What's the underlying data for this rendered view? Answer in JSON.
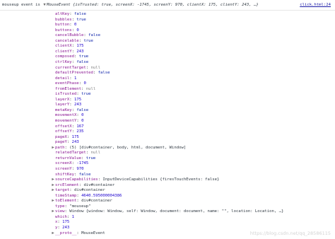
{
  "header": {
    "label": "mouseup event is",
    "preview_prefix": "MouseEvent ",
    "preview_body": "{isTrusted: true, screenX: -1745, screenY: 970, clientX: 175, clientY: 243, …}",
    "source_link": "click.html:24"
  },
  "props": [
    {
      "key": "altKey",
      "value": "false",
      "type": "b"
    },
    {
      "key": "bubbles",
      "value": "true",
      "type": "b"
    },
    {
      "key": "button",
      "value": "0",
      "type": "n"
    },
    {
      "key": "buttons",
      "value": "0",
      "type": "n"
    },
    {
      "key": "cancelBubble",
      "value": "false",
      "type": "b"
    },
    {
      "key": "cancelable",
      "value": "true",
      "type": "b"
    },
    {
      "key": "clientX",
      "value": "175",
      "type": "n"
    },
    {
      "key": "clientY",
      "value": "243",
      "type": "n"
    },
    {
      "key": "composed",
      "value": "true",
      "type": "b"
    },
    {
      "key": "ctrlKey",
      "value": "false",
      "type": "b"
    },
    {
      "key": "currentTarget",
      "value": "null",
      "type": "nl"
    },
    {
      "key": "defaultPrevented",
      "value": "false",
      "type": "b"
    },
    {
      "key": "detail",
      "value": "1",
      "type": "n"
    },
    {
      "key": "eventPhase",
      "value": "0",
      "type": "n"
    },
    {
      "key": "fromElement",
      "value": "null",
      "type": "nl"
    },
    {
      "key": "isTrusted",
      "value": "true",
      "type": "b"
    },
    {
      "key": "layerX",
      "value": "175",
      "type": "n"
    },
    {
      "key": "layerY",
      "value": "243",
      "type": "n"
    },
    {
      "key": "metaKey",
      "value": "false",
      "type": "b"
    },
    {
      "key": "movementX",
      "value": "0",
      "type": "n"
    },
    {
      "key": "movementY",
      "value": "0",
      "type": "n"
    },
    {
      "key": "offsetX",
      "value": "167",
      "type": "n"
    },
    {
      "key": "offsetY",
      "value": "235",
      "type": "n"
    },
    {
      "key": "pageX",
      "value": "175",
      "type": "n"
    },
    {
      "key": "pageY",
      "value": "243",
      "type": "n"
    },
    {
      "key": "path",
      "value": "(5) [div#container, body, html, document, Window]",
      "type": "obj",
      "expandable": true
    },
    {
      "key": "relatedTarget",
      "value": "null",
      "type": "nl"
    },
    {
      "key": "returnValue",
      "value": "true",
      "type": "b"
    },
    {
      "key": "screenX",
      "value": "-1745",
      "type": "n"
    },
    {
      "key": "screenY",
      "value": "970",
      "type": "n"
    },
    {
      "key": "shiftKey",
      "value": "false",
      "type": "b"
    },
    {
      "key": "sourceCapabilities",
      "value": "InputDeviceCapabilities {firesTouchEvents: false}",
      "type": "obj",
      "expandable": true
    },
    {
      "key": "srcElement",
      "value": "div#container",
      "type": "obj",
      "expandable": true
    },
    {
      "key": "target",
      "value": "div#container",
      "type": "obj",
      "expandable": true
    },
    {
      "key": "timeStamp",
      "value": "4640.595000004386",
      "type": "n"
    },
    {
      "key": "toElement",
      "value": "div#container",
      "type": "obj",
      "expandable": true
    },
    {
      "key": "type",
      "value": "\"mouseup\"",
      "type": "s"
    },
    {
      "key": "view",
      "value": "Window {window: Window, self: Window, document: document, name: \"\", location: Location, …}",
      "type": "obj",
      "expandable": true
    },
    {
      "key": "which",
      "value": "1",
      "type": "n"
    },
    {
      "key": "x",
      "value": "175",
      "type": "n"
    },
    {
      "key": "y",
      "value": "243",
      "type": "n"
    },
    {
      "key": "__proto__",
      "value": "MouseEvent",
      "type": "obj",
      "expandable": true
    }
  ],
  "watermark": "https://blog.csdn.net/qq_28586115"
}
